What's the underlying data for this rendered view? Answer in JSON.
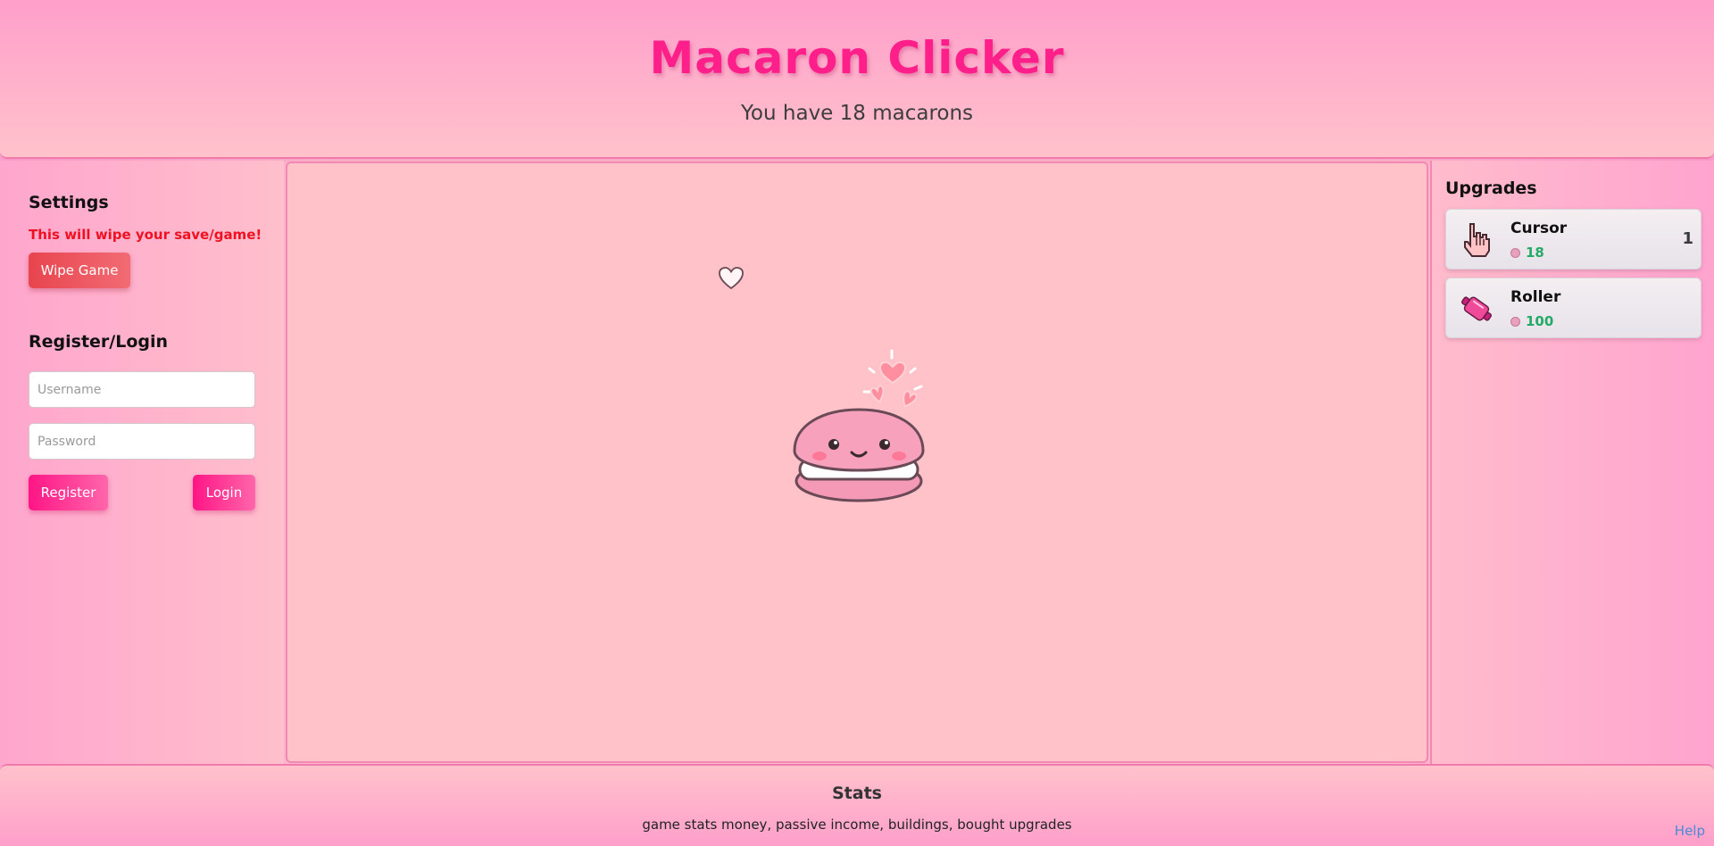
{
  "header": {
    "title": "Macaron Clicker",
    "count_text": "You have 18 macarons"
  },
  "settings": {
    "title": "Settings",
    "warning": "This will wipe your save/game!",
    "wipe_label": "Wipe Game"
  },
  "auth": {
    "title": "Register/Login",
    "username_placeholder": "Username",
    "password_placeholder": "Password",
    "register_label": "Register",
    "login_label": "Login"
  },
  "upgrades": {
    "title": "Upgrades",
    "items": [
      {
        "name": "Cursor",
        "cost": "18",
        "owned": "1",
        "icon": "pointer-hand-icon"
      },
      {
        "name": "Roller",
        "cost": "100",
        "owned": "",
        "icon": "rolling-pin-icon"
      }
    ]
  },
  "game": {
    "macaron_icon": "macaron-icon",
    "floating_icon": "heart-outline-icon"
  },
  "footer": {
    "stats_title": "Stats",
    "stats_desc": "game stats money, passive income, buildings, bought upgrades",
    "help_label": "Help"
  },
  "colors": {
    "title": "#ff1f8a",
    "wipe": "#e8454e",
    "accent": "#ff1585",
    "cost": "#22aa66"
  }
}
